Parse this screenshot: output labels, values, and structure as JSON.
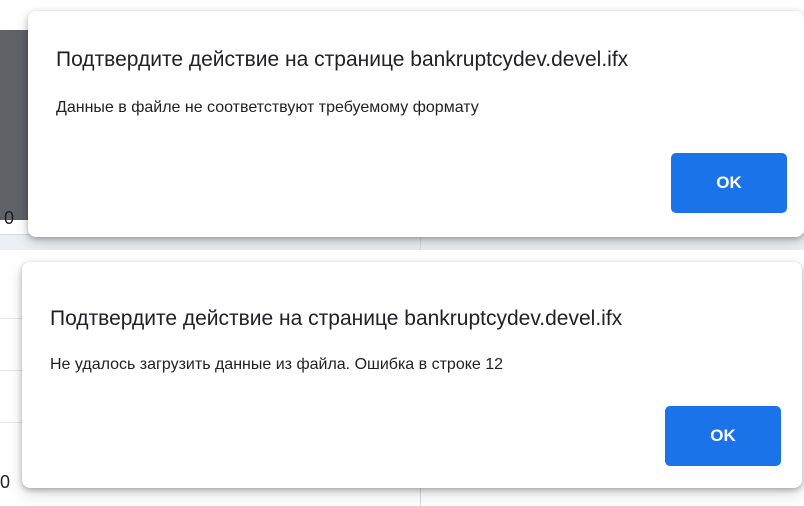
{
  "dialogs": [
    {
      "title": "Подтвердите действие на странице bankruptcydev.devel.ifx",
      "message": "Данные в файле не соответствуют требуемому формату",
      "ok_label": "OK"
    },
    {
      "title": "Подтвердите действие на странице bankruptcydev.devel.ifx",
      "message": "Не удалось загрузить данные из файла. Ошибка в строке 12",
      "ok_label": "OK"
    }
  ],
  "background": {
    "glyph": "0"
  },
  "colors": {
    "button": "#1a73e8",
    "dialog_bg": "#ffffff",
    "text": "#202124"
  }
}
